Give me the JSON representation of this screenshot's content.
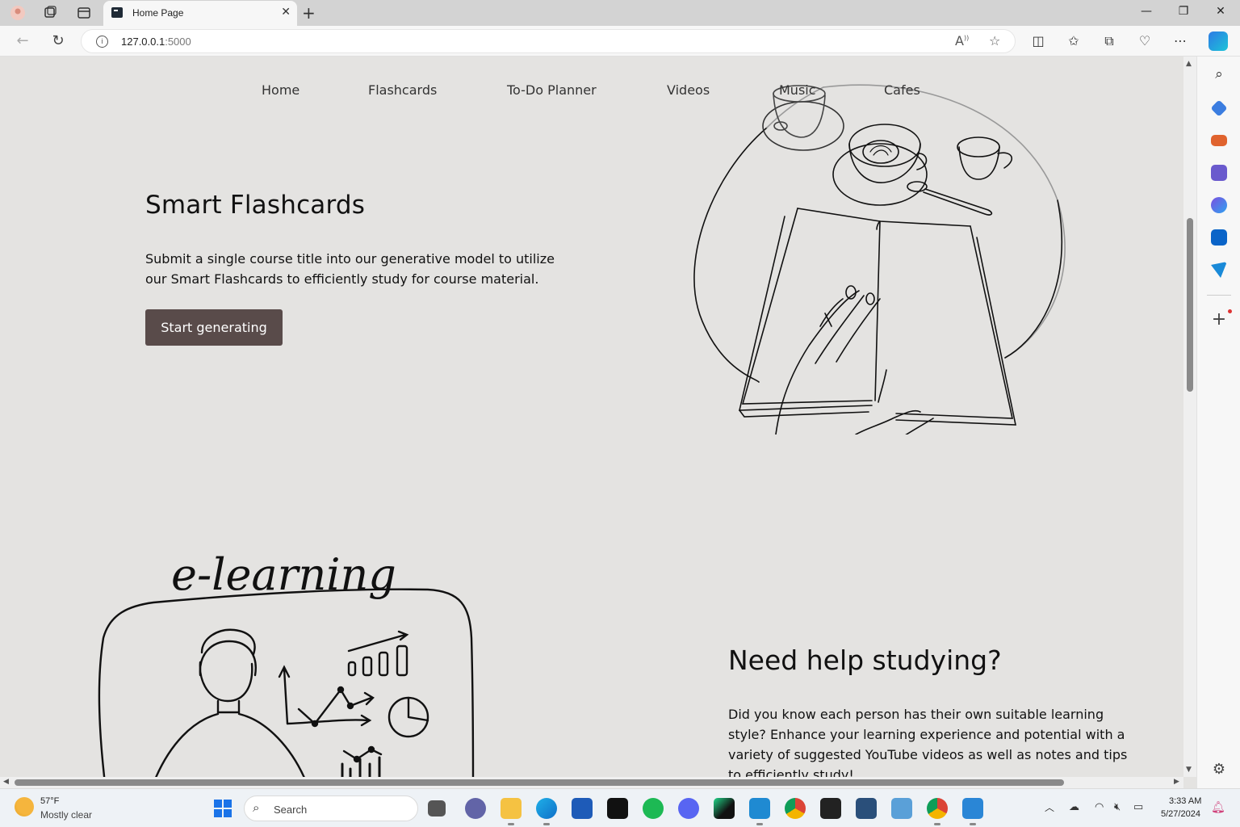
{
  "browser": {
    "tab_title": "Home Page",
    "url_host": "127.0.0.1",
    "url_port": ":5000",
    "icons": [
      "profile-icon",
      "workspaces-icon",
      "tab-actions-icon",
      "close-icon",
      "plus-icon",
      "minimize-icon",
      "maximize-icon",
      "close-window-icon",
      "back-icon",
      "refresh-icon",
      "info-icon",
      "read-aloud-icon",
      "favorite-star-icon",
      "split-screen-icon",
      "favorites-icon",
      "collections-icon",
      "browser-essentials-icon",
      "more-icon",
      "copilot-icon"
    ]
  },
  "site": {
    "nav": [
      "Home",
      "Flashcards",
      "To-Do Planner",
      "Videos",
      "Music",
      "Cafes"
    ],
    "hero": {
      "title": "Smart Flashcards",
      "description": "Submit a single course title into our generative model to utilize our Smart Flashcards to efficiently study for course material.",
      "button": "Start generating"
    },
    "elearning_text": "e-learning",
    "help": {
      "title": "Need help studying?",
      "description": "Did you know each person has their own suitable learning style? Enhance your learning experience and potential with a variety of suggested YouTube videos as well as notes and tips to efficiently study!"
    }
  },
  "taskbar": {
    "weather_temp": "57°F",
    "weather_condition": "Mostly clear",
    "search_placeholder": "Search",
    "time": "3:33 AM",
    "date": "5/27/2024"
  },
  "colors": {
    "page_background": "#e4e3e1",
    "button_background": "#594b4a",
    "button_text": "#ffffff"
  }
}
